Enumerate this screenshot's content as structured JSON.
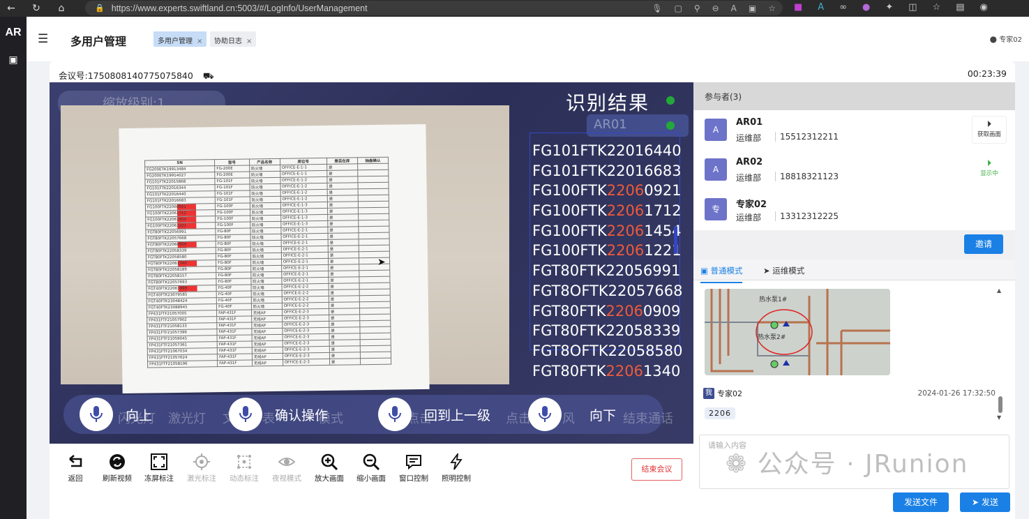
{
  "browser": {
    "url": "https://www.experts.swiftland.cn:5003/#/LogInfo/UserManagement"
  },
  "app": {
    "logo": "AR",
    "title": "多用户管理",
    "tabs": [
      {
        "label": "多用户管理",
        "close": "×"
      },
      {
        "label": "协助日志",
        "close": "×"
      }
    ],
    "user": "专家02"
  },
  "meeting": {
    "id_label": "会议号:1750808140775075840",
    "timer": "00:23:39"
  },
  "video": {
    "result_title": "识别结果",
    "ar_label": "AR01",
    "ghost_texts": [
      "缩放级别:1",
      "闪光灯",
      "激光灯",
      "文字",
      "表",
      "模式",
      "点击",
      "点击",
      "风",
      "结束通话"
    ],
    "codes": [
      {
        "pre": "FG101FTK22016440",
        "red": "",
        "post": ""
      },
      {
        "pre": "FG101FTK22016683",
        "red": "",
        "post": ""
      },
      {
        "pre": "FG100FTK",
        "red": "2206",
        "post": "0921"
      },
      {
        "pre": "FG100FTK",
        "red": "2206",
        "post": "1712"
      },
      {
        "pre": "FG100FTK",
        "red": "2206",
        "post": "1454"
      },
      {
        "pre": "FG100FTK",
        "red": "2206",
        "post": "1221"
      },
      {
        "pre": "FGT80FTK22056991",
        "red": "",
        "post": ""
      },
      {
        "pre": "FGT8OFTK22057668",
        "red": "",
        "post": ""
      },
      {
        "pre": "FGT80FTK",
        "red": "2206",
        "post": "0909"
      },
      {
        "pre": "FGT80FTK22058339",
        "red": "",
        "post": ""
      },
      {
        "pre": "FGT8OFTK22058580",
        "red": "",
        "post": ""
      },
      {
        "pre": "FGT80FTK",
        "red": "2206",
        "post": "1340"
      }
    ],
    "voice_commands": [
      "向上",
      "确认操作",
      "回到上一级",
      "向下"
    ],
    "sheet": {
      "headers": [
        "SN",
        "型号",
        "产品名称",
        "库位号",
        "是否在库",
        "抽盘确认"
      ],
      "rows": [
        [
          "FG200ETK19913484",
          "FG-200E",
          "防火墙",
          "OFFICE-E-1-1",
          "是",
          ""
        ],
        [
          "FG200ETK19914027",
          "FG-200E",
          "防火墙",
          "OFFICE-E-1-1",
          "是",
          ""
        ],
        [
          "FG101FTK22015868",
          "FG-101F",
          "防火墙",
          "OFFICE-E-1-2",
          "是",
          ""
        ],
        [
          "FG101FTK22016344",
          "FG-101F",
          "防火墙",
          "OFFICE-E-1-2",
          "是",
          ""
        ],
        [
          "FG101FTK22016440",
          "FG-101F",
          "防火墙",
          "OFFICE-E-1-2",
          "是",
          ""
        ],
        [
          "FG101FTK22016683",
          "FG-101F",
          "防火墙",
          "OFFICE-E-1-2",
          "是",
          ""
        ],
        [
          "FG100FTK22060921",
          "FG-100F",
          "防火墙",
          "OFFICE-E-1-3",
          "是",
          ""
        ],
        [
          "FG100FTK22061712",
          "FG-100F",
          "防火墙",
          "OFFICE-E-1-3",
          "是",
          ""
        ],
        [
          "FG100FTK22061454",
          "FG-100F",
          "防火墙",
          "OFFICE-E-1-3",
          "是",
          ""
        ],
        [
          "FG100FTK22061221",
          "FG-100F",
          "防火墙",
          "OFFICE-E-1-3",
          "是",
          ""
        ],
        [
          "FGT80FTK22056991",
          "FG-80F",
          "防火墙",
          "OFFICE-E-2-1",
          "是",
          ""
        ],
        [
          "FGT80FTK22057668",
          "FG-80F",
          "防火墙",
          "OFFICE-E-2-1",
          "是",
          ""
        ],
        [
          "FGT80FTK22060909",
          "FG-80F",
          "防火墙",
          "OFFICE-E-2-1",
          "是",
          ""
        ],
        [
          "FGT80FTK22058339",
          "FG-80F",
          "防火墙",
          "OFFICE-E-2-1",
          "是",
          ""
        ],
        [
          "FGT80FTK22058580",
          "FG-80F",
          "防火墙",
          "OFFICE-E-2-1",
          "是",
          ""
        ],
        [
          "FGT80FTK22061340",
          "FG-80F",
          "防火墙",
          "OFFICE-E-2-1",
          "是",
          ""
        ],
        [
          "FGT80FTK22058189",
          "FG-80F",
          "防火墙",
          "OFFICE-E-2-1",
          "是",
          ""
        ],
        [
          "FGT80FTK22058157",
          "FG-80F",
          "防火墙",
          "OFFICE-E-2-1",
          "是",
          ""
        ],
        [
          "FGT80FTK22057693",
          "FG-80F",
          "防火墙",
          "OFFICE-E-2-1",
          "是",
          ""
        ],
        [
          "FGT40FTK22061999",
          "FG-40F",
          "防火墙",
          "OFFICE-E-2-2",
          "是",
          ""
        ],
        [
          "FGT40FTK23079585",
          "FG-40F",
          "防火墙",
          "OFFICE-E-2-2",
          "是",
          ""
        ],
        [
          "FGT40FTK23048424",
          "FG-40F",
          "防火墙",
          "OFFICE-E-2-2",
          "是",
          ""
        ],
        [
          "FGT40FTK23088945",
          "FG-40F",
          "防火墙",
          "OFFICE-E-2-2",
          "是",
          ""
        ],
        [
          "FP431FTF21057005",
          "FAP-431F",
          "无线AP",
          "OFFICE-E-2-3",
          "是",
          ""
        ],
        [
          "FP431FTF21057902",
          "FAP-431F",
          "无线AP",
          "OFFICE-E-2-3",
          "是",
          ""
        ],
        [
          "FP431FTF21058133",
          "FAP-431F",
          "无线AP",
          "OFFICE-E-2-3",
          "是",
          ""
        ],
        [
          "FP431FTF21057396",
          "FAP-431F",
          "无线AP",
          "OFFICE-E-2-3",
          "是",
          ""
        ],
        [
          "FP431FTF21059045",
          "FAP-431F",
          "无线AP",
          "OFFICE-E-2-3",
          "是",
          ""
        ],
        [
          "FP431FTF21057361",
          "FAP-431F",
          "无线AP",
          "OFFICE-E-2-3",
          "是",
          ""
        ],
        [
          "FP431FTF21067034",
          "FAP-431F",
          "无线AP",
          "OFFICE-E-2-3",
          "是",
          ""
        ],
        [
          "FP431FTF21057624",
          "FAP-431F",
          "无线AP",
          "OFFICE-E-2-3",
          "是",
          ""
        ],
        [
          "FP431FTF21058196",
          "FAP-431F",
          "无线AP",
          "OFFICE-E-2-3",
          "是",
          ""
        ]
      ]
    }
  },
  "toolbar": {
    "tools": [
      {
        "label": "返回",
        "icon": "back-icon",
        "disabled": false
      },
      {
        "label": "刷新视频",
        "icon": "refresh-icon",
        "disabled": false
      },
      {
        "label": "冻屏标注",
        "icon": "freeze-icon",
        "disabled": false
      },
      {
        "label": "激光标注",
        "icon": "laser-icon",
        "disabled": true
      },
      {
        "label": "动态标注",
        "icon": "dynamic-annotation-icon",
        "disabled": true
      },
      {
        "label": "夜视模式",
        "icon": "eye-icon",
        "disabled": true
      },
      {
        "label": "放大画面",
        "icon": "zoom-in-icon",
        "disabled": false
      },
      {
        "label": "缩小画面",
        "icon": "zoom-out-icon",
        "disabled": false
      },
      {
        "label": "窗口控制",
        "icon": "chat-window-icon",
        "disabled": false
      },
      {
        "label": "照明控制",
        "icon": "lightning-icon",
        "disabled": false
      }
    ],
    "end_meeting": "结束会议"
  },
  "participants": {
    "header": "参与者(3)",
    "list": [
      {
        "avatar": "A",
        "name": "AR01",
        "dept": "运维部",
        "phone": "15512312211",
        "action": "获取画面",
        "action_state": "normal"
      },
      {
        "avatar": "A",
        "name": "AR02",
        "dept": "运维部",
        "phone": "18818321123",
        "action": "显示中",
        "action_state": "active"
      },
      {
        "avatar": "专",
        "name": "专家02",
        "dept": "运维部",
        "phone": "13312312225",
        "action": "",
        "action_state": "none"
      }
    ],
    "invite": "邀请"
  },
  "chat": {
    "modes": [
      "普通模式",
      "运维模式"
    ],
    "image_labels": [
      "热水泵1#",
      "热水泵2#"
    ],
    "message": {
      "badge": "我",
      "sender": "专家02",
      "time": "2024-01-26 17:32:50",
      "text": "2206"
    },
    "input_placeholder": "请输入内容",
    "watermark": "公众号 · JRunion",
    "send_file": "发送文件",
    "send": "发送"
  },
  "colors": {
    "accent": "#1a80e5",
    "highlight_red": "#f05a3a",
    "avatar": "#6d73c9",
    "active_green": "#3cb043"
  }
}
